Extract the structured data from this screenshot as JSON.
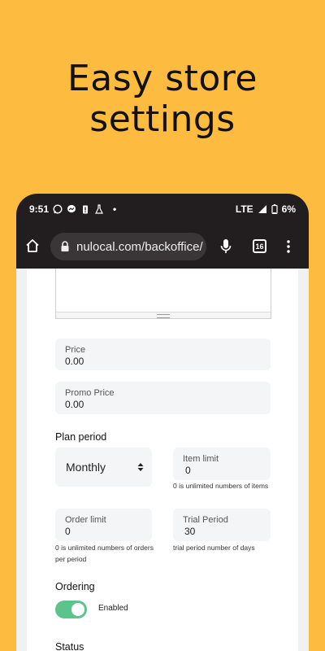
{
  "headline": {
    "line1": "Easy store",
    "line2": "settings"
  },
  "status_bar": {
    "time": "9:51",
    "dot": "•",
    "network": "LTE",
    "battery": "6%"
  },
  "browser": {
    "url": "nulocal.com/backoffice/",
    "tab_count": "16"
  },
  "form": {
    "price": {
      "label": "Price",
      "value": "0.00"
    },
    "promo_price": {
      "label": "Promo Price",
      "value": "0.00"
    },
    "plan_period": {
      "title": "Plan period",
      "value": "Monthly"
    },
    "item_limit": {
      "label": "Item limit",
      "value": "0",
      "hint": "0 is unlimited numbers of items"
    },
    "order_limit": {
      "label": "Order limit",
      "value": "0",
      "hint_line1": "0 is unlimited numbers of orders",
      "hint_line2": "per period"
    },
    "trial_period": {
      "label": "Trial Period",
      "value": "30",
      "hint": "trial period number of days"
    },
    "ordering": {
      "title": "Ordering",
      "toggle_label": "Enabled",
      "enabled": true
    },
    "status": {
      "title": "Status"
    }
  },
  "colors": {
    "background": "#FDBB3F",
    "phone": "#221E1F",
    "toggle_on": "#5CC48A"
  },
  "icons": [
    "whatsapp-icon",
    "messenger-icon",
    "battery-alert-icon",
    "lab-icon",
    "signal-icon",
    "battery-icon",
    "home-icon",
    "lock-icon",
    "mic-icon",
    "tabs-icon",
    "more-vert-icon",
    "chevron-updown-icon"
  ]
}
